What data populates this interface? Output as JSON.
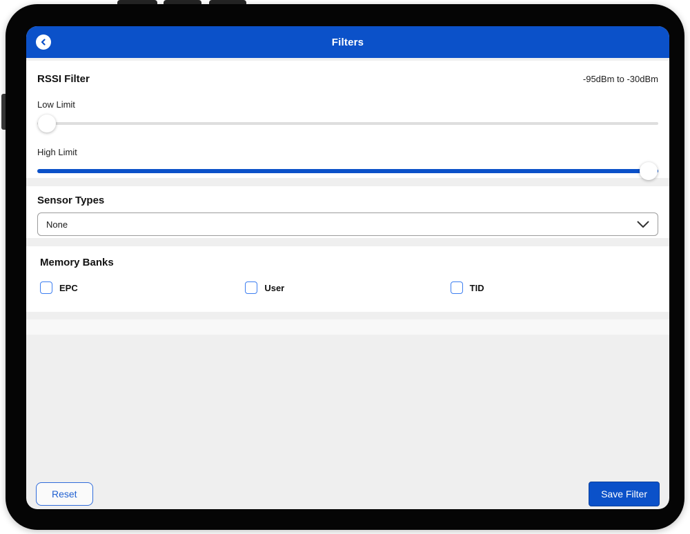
{
  "header": {
    "title": "Filters",
    "back_icon": "chevron-left-icon"
  },
  "rssi": {
    "title": "RSSI Filter",
    "range_label": "-95dBm to -30dBm",
    "low": {
      "label": "Low Limit",
      "value_percent": 0
    },
    "high": {
      "label": "High Limit",
      "value_percent": 100
    }
  },
  "sensor_types": {
    "title": "Sensor Types",
    "selected": "None",
    "dropdown_icon": "chevron-down-icon"
  },
  "memory_banks": {
    "title": "Memory Banks",
    "options": [
      {
        "label": "EPC",
        "checked": false
      },
      {
        "label": "User",
        "checked": false
      },
      {
        "label": "TID",
        "checked": false
      }
    ]
  },
  "footer": {
    "reset_label": "Reset",
    "save_label": "Save Filter"
  },
  "colors": {
    "primary": "#0b51c9",
    "checkbox_border": "#3b7df0",
    "slider_track": "#dedede",
    "screen_background": "#efefef",
    "card_background": "#ffffff"
  }
}
